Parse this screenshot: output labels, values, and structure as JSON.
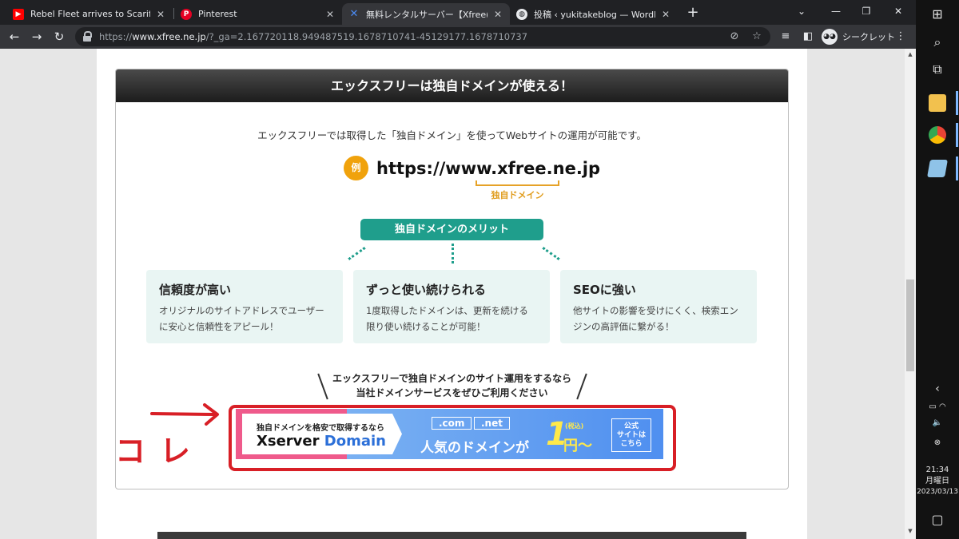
{
  "browser": {
    "tabs": [
      {
        "title": "Rebel Fleet arrives to Scarif Scene",
        "icon": "youtube-icon",
        "active": false
      },
      {
        "title": "Pinterest",
        "icon": "pinterest-icon",
        "active": false
      },
      {
        "title": "無料レンタルサーバー【Xfree(エックスフリー)】",
        "icon": "xfree-icon",
        "active": true
      },
      {
        "title": "投稿 ‹ yukitakeblog — WordPress",
        "icon": "wordpress-icon",
        "active": false
      }
    ],
    "url_scheme": "https://",
    "url_host": "www.xfree.ne.jp",
    "url_rest": "/?_ga=2.167720118.949487519.1678710741-45129177.1678710737",
    "incognito_label": "シークレット"
  },
  "page": {
    "section_title": "エックスフリーは独自ドメインが使える！",
    "lead": "エックスフリーでは取得した「独自ドメイン」を使ってWebサイトの運用が可能です。",
    "example_badge": "例",
    "example_url": "https://www.xfree.ne.jp",
    "example_domain_label": "独自ドメイン",
    "merit_heading": "独自ドメインのメリット",
    "merits": [
      {
        "title": "信頼度が高い",
        "desc": "オリジナルのサイトアドレスでユーザーに安心と信頼性をアピール！"
      },
      {
        "title": "ずっと使い続けられる",
        "desc": "1度取得したドメインは、更新を続ける限り使い続けることが可能！"
      },
      {
        "title": "SEOに強い",
        "desc": "他サイトの影響を受けにくく、検索エンジンの高評価に繋がる！"
      }
    ],
    "cta_line1": "エックスフリーで独自ドメインのサイト運用をするなら",
    "cta_line2": "当社ドメインサービスをぜひご利用ください",
    "banner": {
      "sub": "独自ドメインを格安で取得するなら",
      "brand1": "Xserver",
      "brand2": "Domain",
      "tld1": ".com",
      "tld2": ".net",
      "popular": "人気のドメインが",
      "price_num": "1",
      "price_unit": "円〜",
      "tax": "(税込)",
      "official_line1": "公式",
      "official_line2": "サイトは",
      "official_line3": "こちら"
    },
    "annotation": "コレ",
    "annotation_color": "#d81f26",
    "accent_teal": "#1f9e8c",
    "accent_orange": "#f0a20c"
  },
  "taskbar": {
    "time": "21:34",
    "weekday": "月曜日",
    "date": "2023/03/13"
  }
}
